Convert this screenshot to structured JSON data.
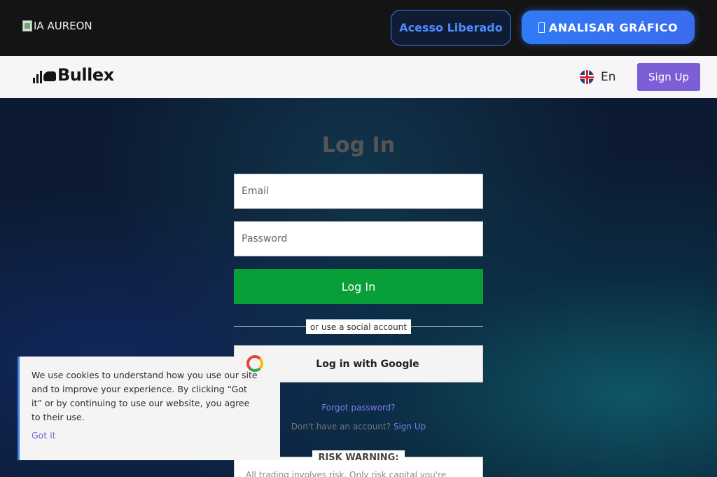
{
  "topbar": {
    "logo_alt": "IA AUREON",
    "acesso_label": "Acesso Liberado",
    "analisar_label": "ANALISAR GRÁFICO"
  },
  "header": {
    "brand": "Bullex",
    "language": "En",
    "signup_label": "Sign Up"
  },
  "login": {
    "title": "Log In",
    "email_placeholder": "Email",
    "password_placeholder": "Password",
    "submit_label": "Log In",
    "social_divider": "or use a social account",
    "google_label": "Log in with Google",
    "forgot_label": "Forgot password?",
    "no_account_text": "Don't have an account?",
    "signup_link": "Sign Up"
  },
  "risk": {
    "label": "RISK WARNING:",
    "text": "All trading involves risk. Only risk capital you're"
  },
  "cookie": {
    "text": "We use cookies to understand how you use our site and to improve your experience. By clicking “Got it” or by continuing to use our website, you agree to their use.",
    "accept_label": "Got it"
  }
}
